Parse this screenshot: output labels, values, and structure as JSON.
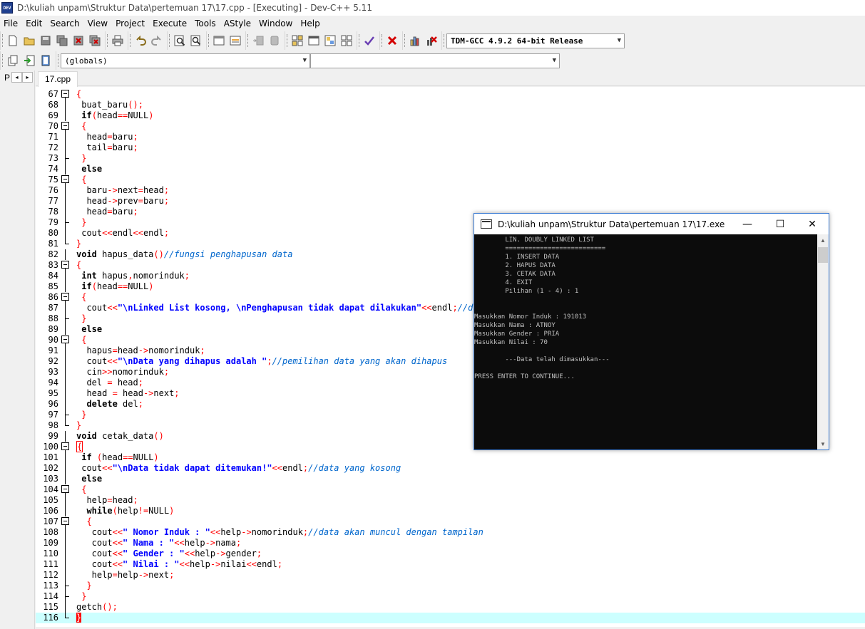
{
  "window": {
    "title": "D:\\kuliah unpam\\Struktur Data\\pertemuan 17\\17.cpp - [Executing] - Dev-C++ 5.11",
    "icon_text": "DEV"
  },
  "menu": [
    "File",
    "Edit",
    "Search",
    "View",
    "Project",
    "Execute",
    "Tools",
    "AStyle",
    "Window",
    "Help"
  ],
  "toolbar": {
    "compiler": "TDM-GCC 4.9.2 64-bit Release",
    "scope": "(globals)",
    "member": ""
  },
  "left_pane": {
    "label": "P",
    "arrow_left": "◂",
    "arrow_right": "▸"
  },
  "tabs": [
    {
      "label": "17.cpp"
    }
  ],
  "editor": {
    "lines": [
      {
        "n": "67",
        "html": "<span class=\"p\">{</span>"
      },
      {
        "n": "68",
        "html": " buat_baru<span class=\"p\">();</span>"
      },
      {
        "n": "69",
        "html": " <span class=\"k\">if</span><span class=\"p\">(</span>head<span class=\"o\">==</span>NULL<span class=\"p\">)</span>"
      },
      {
        "n": "70",
        "html": " <span class=\"p\">{</span>"
      },
      {
        "n": "71",
        "html": "  head<span class=\"o\">=</span>baru<span class=\"p\">;</span>"
      },
      {
        "n": "72",
        "html": "  tail<span class=\"o\">=</span>baru<span class=\"p\">;</span>"
      },
      {
        "n": "73",
        "html": " <span class=\"p\">}</span>"
      },
      {
        "n": "74",
        "html": " <span class=\"k\">else</span>"
      },
      {
        "n": "75",
        "html": " <span class=\"p\">{</span>"
      },
      {
        "n": "76",
        "html": "  baru<span class=\"o\">-&gt;</span>next<span class=\"o\">=</span>head<span class=\"p\">;</span>"
      },
      {
        "n": "77",
        "html": "  head<span class=\"o\">-&gt;</span>prev<span class=\"o\">=</span>baru<span class=\"p\">;</span>"
      },
      {
        "n": "78",
        "html": "  head<span class=\"o\">=</span>baru<span class=\"p\">;</span>"
      },
      {
        "n": "79",
        "html": " <span class=\"p\">}</span>"
      },
      {
        "n": "80",
        "html": " cout<span class=\"o\">&lt;&lt;</span>endl<span class=\"o\">&lt;&lt;</span>endl<span class=\"p\">;</span>"
      },
      {
        "n": "81",
        "html": "<span class=\"p\">}</span>"
      },
      {
        "n": "82",
        "html": "<span class=\"k\">void</span> hapus_data<span class=\"p\">()</span><span class=\"c\">//fungsi penghapusan data</span>"
      },
      {
        "n": "83",
        "html": "<span class=\"p\">{</span>"
      },
      {
        "n": "84",
        "html": " <span class=\"k\">int</span> hapus<span class=\"p\">,</span>nomorinduk<span class=\"p\">;</span>"
      },
      {
        "n": "85",
        "html": " <span class=\"k\">if</span><span class=\"p\">(</span>head<span class=\"o\">==</span>NULL<span class=\"p\">)</span>"
      },
      {
        "n": "86",
        "html": " <span class=\"p\">{</span>"
      },
      {
        "n": "87",
        "html": "  cout<span class=\"o\">&lt;&lt;</span><span class=\"s\">\"\\nLinked List kosong, \\nPenghapusan tidak dapat dilakukan\"</span><span class=\"o\">&lt;&lt;</span>endl<span class=\"p\">;</span><span class=\"c\">//data kosong</span>"
      },
      {
        "n": "88",
        "html": " <span class=\"p\">}</span>"
      },
      {
        "n": "89",
        "html": " <span class=\"k\">else</span>"
      },
      {
        "n": "90",
        "html": " <span class=\"p\">{</span>"
      },
      {
        "n": "91",
        "html": "  hapus<span class=\"o\">=</span>head<span class=\"o\">-&gt;</span>nomorinduk<span class=\"p\">;</span>"
      },
      {
        "n": "92",
        "html": "  cout<span class=\"o\">&lt;&lt;</span><span class=\"s\">\"\\nData yang dihapus adalah \"</span><span class=\"p\">;</span><span class=\"c\">//pemilihan data yang akan dihapus</span>"
      },
      {
        "n": "93",
        "html": "  cin<span class=\"o\">&gt;&gt;</span>nomorinduk<span class=\"p\">;</span>"
      },
      {
        "n": "94",
        "html": "  del <span class=\"o\">=</span> head<span class=\"p\">;</span>"
      },
      {
        "n": "95",
        "html": "  head <span class=\"o\">=</span> head<span class=\"o\">-&gt;</span>next<span class=\"p\">;</span>"
      },
      {
        "n": "96",
        "html": "  <span class=\"k\">delete</span> del<span class=\"p\">;</span>"
      },
      {
        "n": "97",
        "html": " <span class=\"p\">}</span>"
      },
      {
        "n": "98",
        "html": "<span class=\"p\">}</span>"
      },
      {
        "n": "99",
        "html": "<span class=\"k\">void</span> cetak_data<span class=\"p\">()</span>"
      },
      {
        "n": "100",
        "html": "<span class=\"brace-hl\">{</span>"
      },
      {
        "n": "101",
        "html": " <span class=\"k\">if</span> <span class=\"p\">(</span>head<span class=\"o\">==</span>NULL<span class=\"p\">)</span>"
      },
      {
        "n": "102",
        "html": " cout<span class=\"o\">&lt;&lt;</span><span class=\"s\">\"\\nData tidak dapat ditemukan!\"</span><span class=\"o\">&lt;&lt;</span>endl<span class=\"p\">;</span><span class=\"c\">//data yang kosong</span>"
      },
      {
        "n": "103",
        "html": " <span class=\"k\">else</span>"
      },
      {
        "n": "104",
        "html": " <span class=\"p\">{</span>"
      },
      {
        "n": "105",
        "html": "  help<span class=\"o\">=</span>head<span class=\"p\">;</span>"
      },
      {
        "n": "106",
        "html": "  <span class=\"k\">while</span><span class=\"p\">(</span>help<span class=\"o\">!=</span>NULL<span class=\"p\">)</span>"
      },
      {
        "n": "107",
        "html": "  <span class=\"p\">{</span>"
      },
      {
        "n": "108",
        "html": "   cout<span class=\"o\">&lt;&lt;</span><span class=\"s\">\" Nomor Induk : \"</span><span class=\"o\">&lt;&lt;</span>help<span class=\"o\">-&gt;</span>nomorinduk<span class=\"p\">;</span><span class=\"c\">//data akan muncul dengan tampilan</span>"
      },
      {
        "n": "109",
        "html": "   cout<span class=\"o\">&lt;&lt;</span><span class=\"s\">\" Nama : \"</span><span class=\"o\">&lt;&lt;</span>help<span class=\"o\">-&gt;</span>nama<span class=\"p\">;</span>"
      },
      {
        "n": "110",
        "html": "   cout<span class=\"o\">&lt;&lt;</span><span class=\"s\">\" Gender : \"</span><span class=\"o\">&lt;&lt;</span>help<span class=\"o\">-&gt;</span>gender<span class=\"p\">;</span>"
      },
      {
        "n": "111",
        "html": "   cout<span class=\"o\">&lt;&lt;</span><span class=\"s\">\" Nilai : \"</span><span class=\"o\">&lt;&lt;</span>help<span class=\"o\">-&gt;</span>nilai<span class=\"o\">&lt;&lt;</span>endl<span class=\"p\">;</span>"
      },
      {
        "n": "112",
        "html": "   help<span class=\"o\">=</span>help<span class=\"o\">-&gt;</span>next<span class=\"p\">;</span>"
      },
      {
        "n": "113",
        "html": "  <span class=\"p\">}</span>"
      },
      {
        "n": "114",
        "html": " <span class=\"p\">}</span>"
      },
      {
        "n": "115",
        "html": "getch<span class=\"p\">();</span>"
      },
      {
        "n": "116",
        "html": "<span class=\"cursor-brace\">}</span>"
      }
    ]
  },
  "console": {
    "title": "D:\\kuliah unpam\\Struktur Data\\pertemuan 17\\17.exe",
    "minimize": "—",
    "maximize": "☐",
    "close": "✕",
    "lines": [
      "        LIN. DOUBLY LINKED LIST",
      "        ==========================",
      "        1. INSERT DATA",
      "        2. HAPUS DATA",
      "        3. CETAK DATA",
      "        4. EXIT",
      "        Pilihan (1 - 4) : 1",
      "",
      "",
      "Masukkan Nomor Induk : 191013",
      "Masukkan Nama : ATNOY",
      "Masukkan Gender : PRIA",
      "Masukkan Nilai : 70",
      "",
      "        ---Data telah dimasukkan---",
      "",
      "PRESS ENTER TO CONTINUE..."
    ]
  }
}
